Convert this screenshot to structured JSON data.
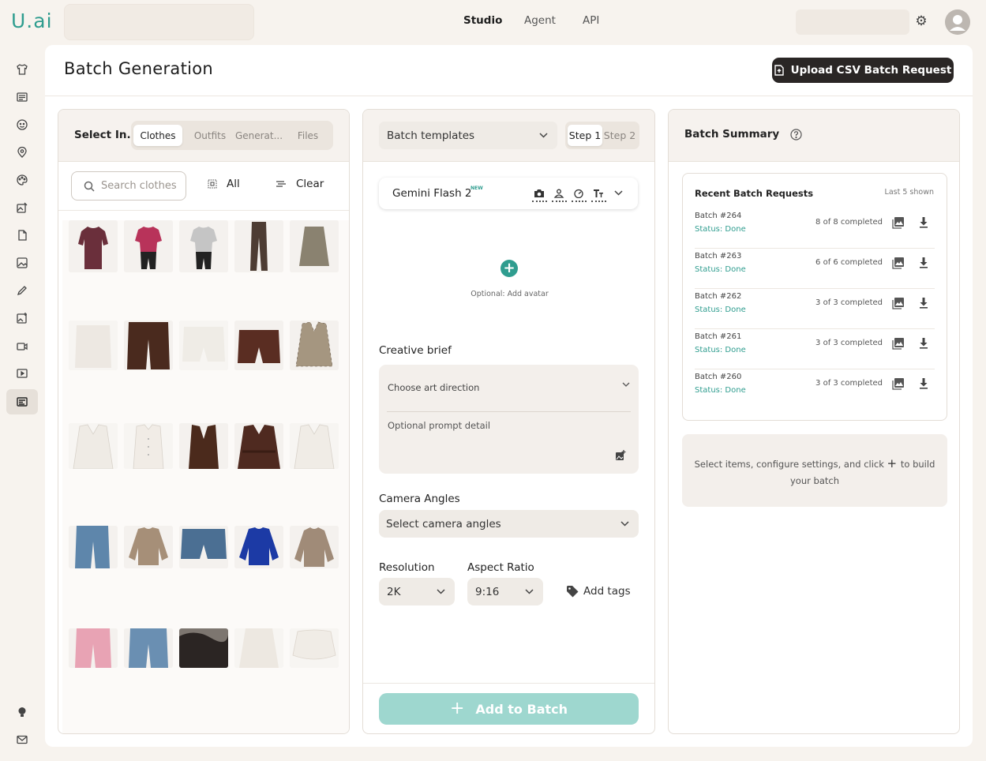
{
  "brand": {
    "logo": "U.ai",
    "accent": "#2f9d8f"
  },
  "topnav": [
    "Studio",
    "Agent",
    "API"
  ],
  "page": {
    "title": "Batch Generation",
    "upload_label": "Upload CSV Batch Request"
  },
  "select_panel": {
    "label": "Select In...",
    "tabs": [
      "Clothes",
      "Outfits",
      "Generat...",
      "Files"
    ],
    "active_tab": "Clothes",
    "search_placeholder": "Search clothes",
    "all_label": "All",
    "clear_label": "Clear"
  },
  "config_panel": {
    "template_placeholder": "Batch templates",
    "steps": [
      "Step 1",
      "Step 2"
    ],
    "model_name": "Gemini Flash 2",
    "model_badge": "NEW",
    "avatar_label": "Optional: Add avatar",
    "brief_label": "Creative brief",
    "art_direction": "Choose art direction",
    "prompt_placeholder": "Optional prompt detail",
    "camera_label": "Camera Angles",
    "camera_placeholder": "Select camera angles",
    "resolution_label": "Resolution",
    "resolution_value": "2K",
    "aspect_label": "Aspect Ratio",
    "aspect_value": "9:16",
    "tags_label": "Add tags",
    "add_batch_label": "Add to Batch"
  },
  "summary_panel": {
    "title": "Batch Summary",
    "recent_title": "Recent Batch Requests",
    "recent_note": "Last 5 shown",
    "batches": [
      {
        "name": "Batch #264",
        "status": "Status: Done",
        "count": "8 of 8 completed"
      },
      {
        "name": "Batch #263",
        "status": "Status: Done",
        "count": "6 of 6 completed"
      },
      {
        "name": "Batch #262",
        "status": "Status: Done",
        "count": "3 of 3 completed"
      },
      {
        "name": "Batch #261",
        "status": "Status: Done",
        "count": "3 of 3 completed"
      },
      {
        "name": "Batch #260",
        "status": "Status: Done",
        "count": "3 of 3 completed"
      }
    ],
    "empty_text_1": "Select items, configure settings, and click",
    "empty_text_2": "to build your batch"
  }
}
